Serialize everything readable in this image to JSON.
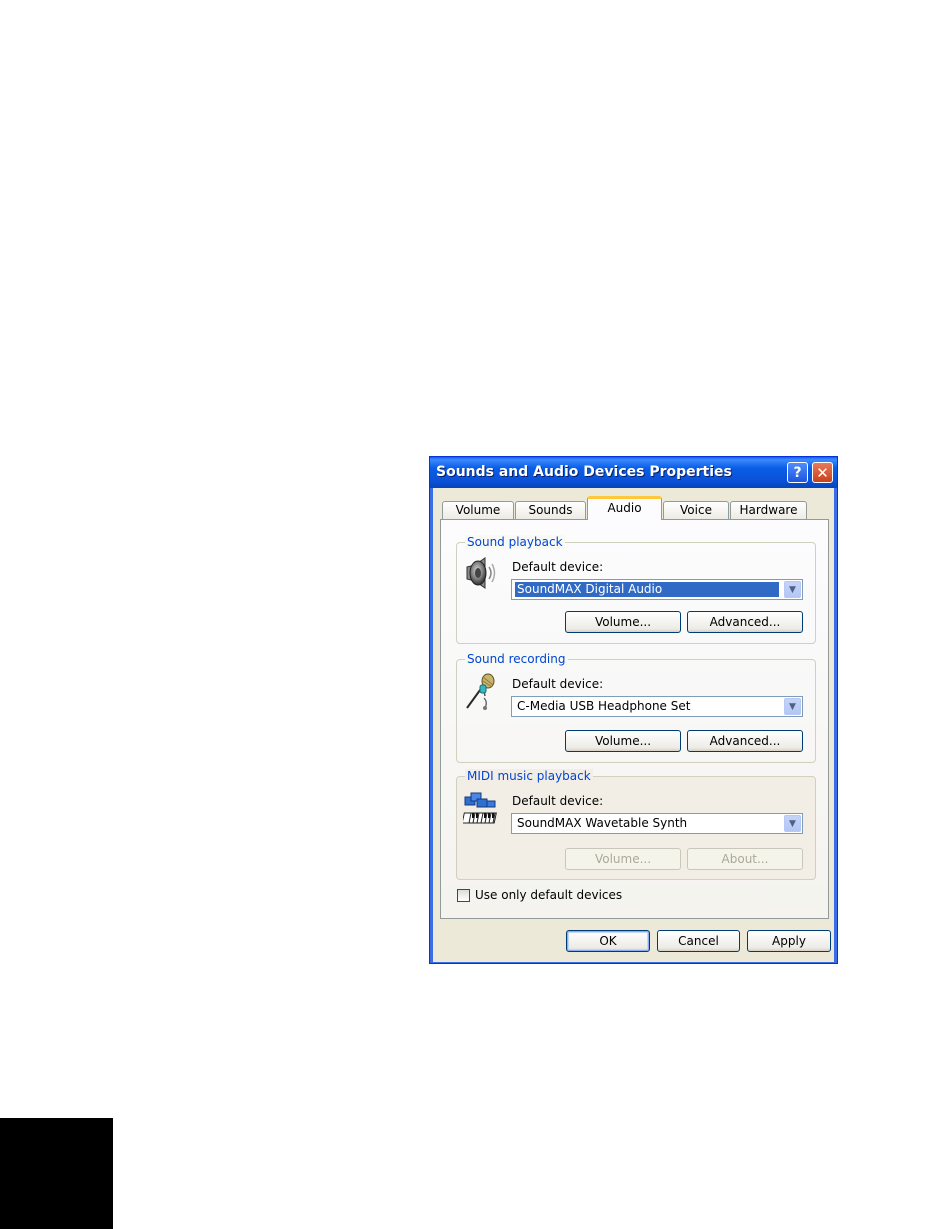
{
  "window": {
    "title": "Sounds and Audio Devices Properties",
    "help_glyph": "?",
    "close_glyph": "✕"
  },
  "tabs": [
    {
      "label": "Volume",
      "active": false
    },
    {
      "label": "Sounds",
      "active": false
    },
    {
      "label": "Audio",
      "active": true
    },
    {
      "label": "Voice",
      "active": false
    },
    {
      "label": "Hardware",
      "active": false
    }
  ],
  "groups": {
    "playback": {
      "title": "Sound playback",
      "device_label": "Default device:",
      "device_value": "SoundMAX Digital Audio",
      "volume_label": "Volume...",
      "advanced_label": "Advanced...",
      "icon": "speaker-icon"
    },
    "recording": {
      "title": "Sound recording",
      "device_label": "Default device:",
      "device_value": "C-Media USB Headphone Set",
      "volume_label": "Volume...",
      "advanced_label": "Advanced...",
      "icon": "microphone-icon"
    },
    "midi": {
      "title": "MIDI music playback",
      "device_label": "Default device:",
      "device_value": "SoundMAX Wavetable Synth",
      "volume_label": "Volume...",
      "about_label": "About...",
      "icon": "midi-keyboard-icon"
    }
  },
  "checkbox": {
    "label": "Use only default devices",
    "checked": false
  },
  "buttons": {
    "ok": "OK",
    "cancel": "Cancel",
    "apply": "Apply"
  },
  "colors": {
    "titlebar": "#0a5ef8",
    "group_title": "#0046d5",
    "selection": "#316ac5",
    "active_tab_highlight": "#ffc83c",
    "dialog_face": "#ece9d8"
  }
}
